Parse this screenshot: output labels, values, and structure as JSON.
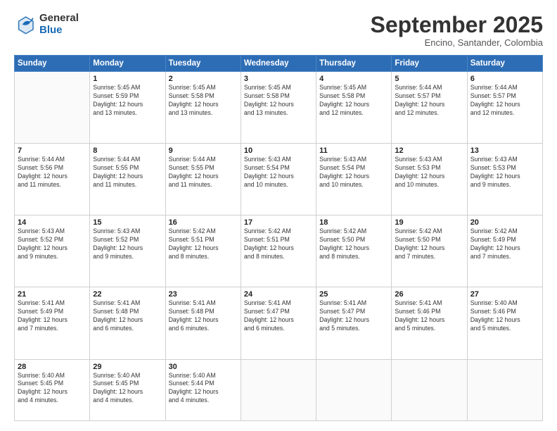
{
  "logo": {
    "general": "General",
    "blue": "Blue"
  },
  "title": "September 2025",
  "subtitle": "Encino, Santander, Colombia",
  "days": [
    "Sunday",
    "Monday",
    "Tuesday",
    "Wednesday",
    "Thursday",
    "Friday",
    "Saturday"
  ],
  "weeks": [
    [
      {
        "num": "",
        "content": ""
      },
      {
        "num": "1",
        "content": "Sunrise: 5:45 AM\nSunset: 5:59 PM\nDaylight: 12 hours\nand 13 minutes."
      },
      {
        "num": "2",
        "content": "Sunrise: 5:45 AM\nSunset: 5:58 PM\nDaylight: 12 hours\nand 13 minutes."
      },
      {
        "num": "3",
        "content": "Sunrise: 5:45 AM\nSunset: 5:58 PM\nDaylight: 12 hours\nand 13 minutes."
      },
      {
        "num": "4",
        "content": "Sunrise: 5:45 AM\nSunset: 5:58 PM\nDaylight: 12 hours\nand 12 minutes."
      },
      {
        "num": "5",
        "content": "Sunrise: 5:44 AM\nSunset: 5:57 PM\nDaylight: 12 hours\nand 12 minutes."
      },
      {
        "num": "6",
        "content": "Sunrise: 5:44 AM\nSunset: 5:57 PM\nDaylight: 12 hours\nand 12 minutes."
      }
    ],
    [
      {
        "num": "7",
        "content": "Sunrise: 5:44 AM\nSunset: 5:56 PM\nDaylight: 12 hours\nand 11 minutes."
      },
      {
        "num": "8",
        "content": "Sunrise: 5:44 AM\nSunset: 5:55 PM\nDaylight: 12 hours\nand 11 minutes."
      },
      {
        "num": "9",
        "content": "Sunrise: 5:44 AM\nSunset: 5:55 PM\nDaylight: 12 hours\nand 11 minutes."
      },
      {
        "num": "10",
        "content": "Sunrise: 5:43 AM\nSunset: 5:54 PM\nDaylight: 12 hours\nand 10 minutes."
      },
      {
        "num": "11",
        "content": "Sunrise: 5:43 AM\nSunset: 5:54 PM\nDaylight: 12 hours\nand 10 minutes."
      },
      {
        "num": "12",
        "content": "Sunrise: 5:43 AM\nSunset: 5:53 PM\nDaylight: 12 hours\nand 10 minutes."
      },
      {
        "num": "13",
        "content": "Sunrise: 5:43 AM\nSunset: 5:53 PM\nDaylight: 12 hours\nand 9 minutes."
      }
    ],
    [
      {
        "num": "14",
        "content": "Sunrise: 5:43 AM\nSunset: 5:52 PM\nDaylight: 12 hours\nand 9 minutes."
      },
      {
        "num": "15",
        "content": "Sunrise: 5:43 AM\nSunset: 5:52 PM\nDaylight: 12 hours\nand 9 minutes."
      },
      {
        "num": "16",
        "content": "Sunrise: 5:42 AM\nSunset: 5:51 PM\nDaylight: 12 hours\nand 8 minutes."
      },
      {
        "num": "17",
        "content": "Sunrise: 5:42 AM\nSunset: 5:51 PM\nDaylight: 12 hours\nand 8 minutes."
      },
      {
        "num": "18",
        "content": "Sunrise: 5:42 AM\nSunset: 5:50 PM\nDaylight: 12 hours\nand 8 minutes."
      },
      {
        "num": "19",
        "content": "Sunrise: 5:42 AM\nSunset: 5:50 PM\nDaylight: 12 hours\nand 7 minutes."
      },
      {
        "num": "20",
        "content": "Sunrise: 5:42 AM\nSunset: 5:49 PM\nDaylight: 12 hours\nand 7 minutes."
      }
    ],
    [
      {
        "num": "21",
        "content": "Sunrise: 5:41 AM\nSunset: 5:49 PM\nDaylight: 12 hours\nand 7 minutes."
      },
      {
        "num": "22",
        "content": "Sunrise: 5:41 AM\nSunset: 5:48 PM\nDaylight: 12 hours\nand 6 minutes."
      },
      {
        "num": "23",
        "content": "Sunrise: 5:41 AM\nSunset: 5:48 PM\nDaylight: 12 hours\nand 6 minutes."
      },
      {
        "num": "24",
        "content": "Sunrise: 5:41 AM\nSunset: 5:47 PM\nDaylight: 12 hours\nand 6 minutes."
      },
      {
        "num": "25",
        "content": "Sunrise: 5:41 AM\nSunset: 5:47 PM\nDaylight: 12 hours\nand 5 minutes."
      },
      {
        "num": "26",
        "content": "Sunrise: 5:41 AM\nSunset: 5:46 PM\nDaylight: 12 hours\nand 5 minutes."
      },
      {
        "num": "27",
        "content": "Sunrise: 5:40 AM\nSunset: 5:46 PM\nDaylight: 12 hours\nand 5 minutes."
      }
    ],
    [
      {
        "num": "28",
        "content": "Sunrise: 5:40 AM\nSunset: 5:45 PM\nDaylight: 12 hours\nand 4 minutes."
      },
      {
        "num": "29",
        "content": "Sunrise: 5:40 AM\nSunset: 5:45 PM\nDaylight: 12 hours\nand 4 minutes."
      },
      {
        "num": "30",
        "content": "Sunrise: 5:40 AM\nSunset: 5:44 PM\nDaylight: 12 hours\nand 4 minutes."
      },
      {
        "num": "",
        "content": ""
      },
      {
        "num": "",
        "content": ""
      },
      {
        "num": "",
        "content": ""
      },
      {
        "num": "",
        "content": ""
      }
    ]
  ]
}
